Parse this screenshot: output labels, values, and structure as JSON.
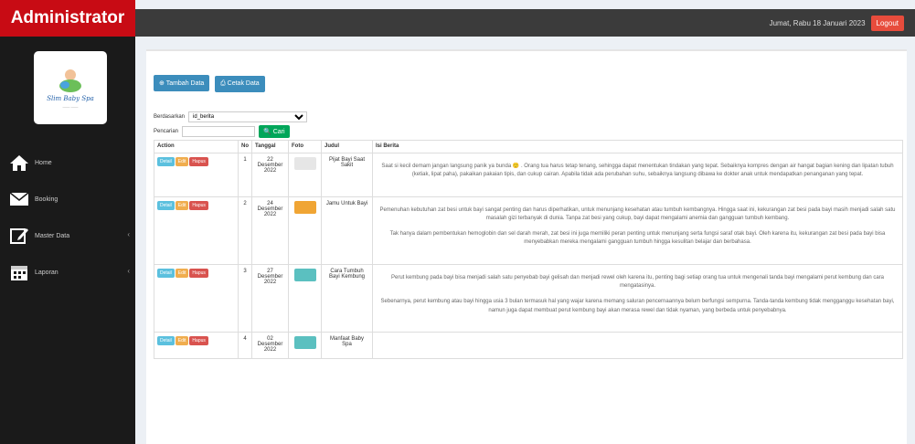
{
  "brand": "Administrator",
  "header": {
    "welcome": "Jumat, Rabu 18 Januari 2023",
    "logout_label": "Logout"
  },
  "logo": {
    "title": "Slim Baby Spa",
    "subtitle": "——  ——"
  },
  "sidebar": {
    "items": [
      {
        "label": "Home",
        "icon": "home-icon"
      },
      {
        "label": "Booking",
        "icon": "envelope-icon"
      },
      {
        "label": "Master Data",
        "icon": "edit-icon",
        "has_caret": true
      },
      {
        "label": "Laporan",
        "icon": "calendar-icon",
        "has_caret": true
      }
    ]
  },
  "toolbar": {
    "add_label": "Tambah Data",
    "print_label": "Cetak Data"
  },
  "filter": {
    "label": "Berdasarkan",
    "selected": "id_berita"
  },
  "search": {
    "label": "Pencarian",
    "placeholder": "",
    "button_label": "Cari"
  },
  "table": {
    "headers": [
      "Action",
      "No",
      "Tanggal",
      "Foto",
      "Judul",
      "Isi Berita"
    ],
    "actions": {
      "detail": "Detail",
      "edit": "Edit",
      "delete": "Hapus"
    },
    "rows": [
      {
        "no": "1",
        "tanggal": "22 Desember 2022",
        "judul": "Pijat Bayi Saat Sakit",
        "photo_color": "#e6e6e6",
        "isi": [
          "Saat si kecil demam jangan langsung panik ya bunda 🙂 . Orang tua harus tetap tenang, sehingga dapat menentukan tindakan yang tepat. Sebaiknya kompres dengan air hangat bagian kening dan lipatan tubuh (ketiak, lipat paha), pakaikan pakaian tipis, dan cukup cairan. Apabila tidak ada perubahan suhu, sebaiknya langsung dibawa ke dokter anak untuk mendapatkan penanganan yang tepat."
        ]
      },
      {
        "no": "2",
        "tanggal": "24 Desember 2022",
        "judul": "Jamu Untuk Bayi",
        "photo_color": "#f0a534",
        "isi": [
          "Pemenuhan kebutuhan zat besi untuk bayi sangat penting dan harus diperhatikan, untuk menunjang kesehatan atau tumbuh kembangnya. Hingga saat ini, kekurangan zat besi pada bayi masih menjadi salah satu masalah gizi terbanyak di dunia. Tanpa zat besi yang cukup, bayi dapat mengalami anemia dan gangguan tumbuh kembang.",
          "Tak hanya dalam pembentukan hemoglobin dan sel darah merah, zat besi ini juga memiliki peran penting untuk menunjang serta fungsi saraf otak bayi. Oleh karena itu, kekurangan zat besi pada bayi bisa menyebabkan mereka mengalami gangguan tumbuh hingga kesulitan belajar dan berbahasa."
        ]
      },
      {
        "no": "3",
        "tanggal": "27 Desember 2022",
        "judul": "Cara Tumbuh Bayi Kembung",
        "photo_color": "#5bc0c0",
        "isi": [
          "Perut kembung pada bayi bisa menjadi salah satu penyebab bayi gelisah dan menjadi rewel oleh karena itu, penting bagi setiap orang tua untuk mengenali tanda bayi mengalami perut kembung dan cara mengatasinya.",
          "Sebenarnya, perut kembung atau bayi hingga usia 3 bulan termasuk hal yang wajar karena memang saluran pencernaannya belum berfungsi sempurna. Tanda-tanda kembung tidak mengganggu kesehatan bayi, namun juga dapat membuat perut kembung bayi akan merasa rewel dan tidak nyaman, yang berbeda untuk penyebabnya."
        ]
      },
      {
        "no": "4",
        "tanggal": "02 Desember 2022",
        "judul": "Manfaat Baby Spa",
        "photo_color": "#5bc0c0",
        "isi": [
          ""
        ]
      }
    ]
  }
}
